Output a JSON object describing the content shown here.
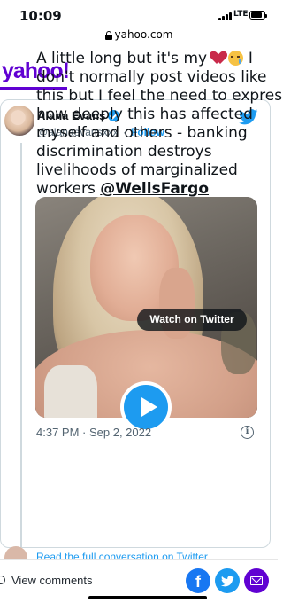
{
  "status_bar": {
    "time": "10:09",
    "network": "LTE"
  },
  "browser": {
    "url": "yahoo.com"
  },
  "site": {
    "logo": "yahoo!",
    "brand_color": "#6001d2"
  },
  "tweet": {
    "author_name": "Alana Evans",
    "author_handle": "@alanaevansxxx",
    "separator": "·",
    "follow_label": "Follow",
    "text_lines": [
      "A little long but it's my",
      "don't normally post videos like",
      "this but I feel the need to express",
      "how deeply this has affected",
      "myself and others - banking",
      "discrimination destroys",
      "livelihoods of  marginalized",
      "workers "
    ],
    "line1_suffix": " I",
    "emojis": [
      "broken-heart-icon",
      "crying-face-icon"
    ],
    "mention": "@WellsFargo",
    "watch_label": "Watch on Twitter",
    "timestamp": "4:37 PM · Sep 2, 2022",
    "info_glyph": "i"
  },
  "next_tweet": {
    "link_text": "Read the full conversation on Twitter"
  },
  "bottom_bar": {
    "view_comments": "View comments",
    "facebook_glyph": "f",
    "share_colors": {
      "facebook": "#1877f2",
      "twitter": "#1d9bf0",
      "mail": "#6001d2"
    }
  }
}
